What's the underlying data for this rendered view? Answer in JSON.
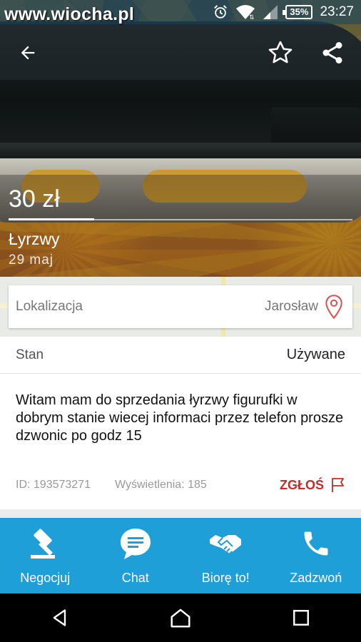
{
  "statusbar": {
    "watermark": "www.wiocha.pl",
    "battery": "35%",
    "time": "23:27",
    "icons": [
      "alarm-icon",
      "wifi-icon",
      "cell-signal-icon",
      "battery-icon"
    ]
  },
  "toolbar": {
    "back_icon": "arrow-back-icon",
    "favorite_icon": "star-outline-icon",
    "share_icon": "share-icon"
  },
  "listing": {
    "price": "30 zł",
    "title": "Łyrzwy",
    "date": "29  maj"
  },
  "location": {
    "label": "Lokalizacja",
    "city": "Jarosław",
    "pin_color": "#e0504f"
  },
  "details": {
    "condition_label": "Stan",
    "condition_value": "Używane",
    "description": "Witam mam do sprzedania łyrzwy figurufki w dobrym stanie wiecej informaci przez telefon prosze dzwonic po godz 15",
    "id_text": "ID: 193573271",
    "views_text": "Wyświetlenia: 185",
    "report_label": "ZGŁOŚ",
    "report_color": "#c62a2a"
  },
  "actions": [
    {
      "label": "Negocjuj",
      "icon": "gavel-icon"
    },
    {
      "label": "Chat",
      "icon": "chat-bubble-icon"
    },
    {
      "label": "Biorę to!",
      "icon": "handshake-icon"
    },
    {
      "label": "Zadzwoń",
      "icon": "phone-icon"
    }
  ],
  "colors": {
    "action_bar": "#1e9fd8",
    "nav_bar": "#000000"
  },
  "navbar": {
    "icons": [
      "nav-back-icon",
      "nav-home-icon",
      "nav-recents-icon"
    ]
  }
}
